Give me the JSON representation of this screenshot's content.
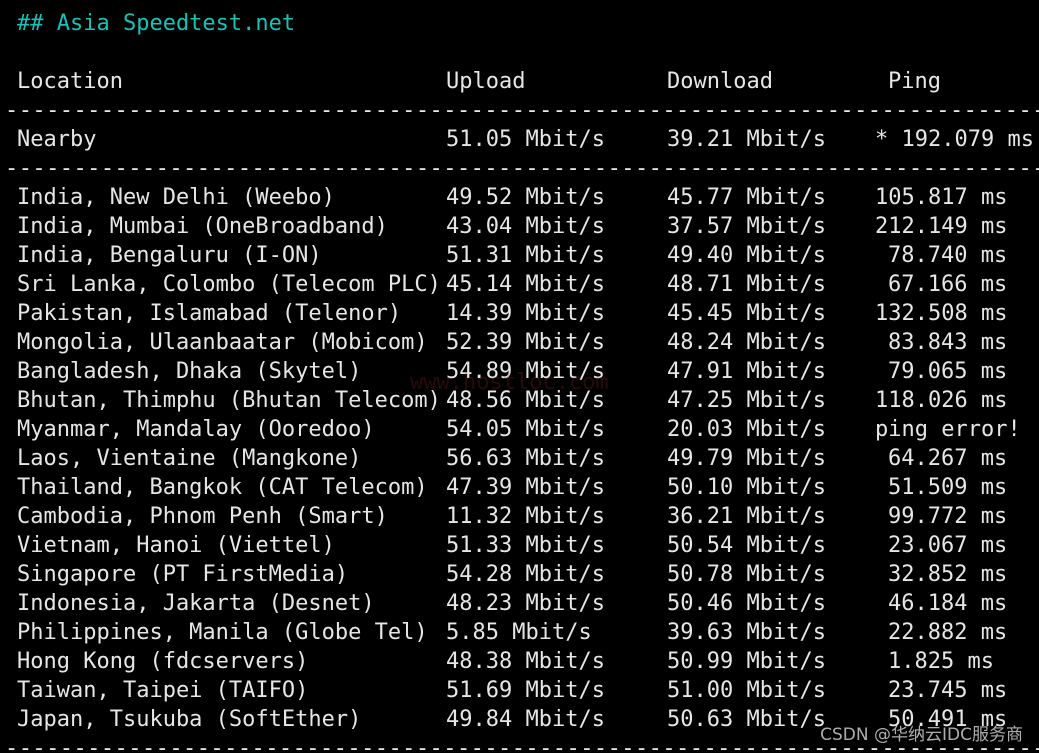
{
  "heading": "## Asia Speedtest.net",
  "columns": {
    "location": "Location",
    "upload": "Upload",
    "download": "Download",
    "ping": "Ping"
  },
  "divider": "----------------------------------------------------------------------------",
  "nearby": {
    "location": "Nearby",
    "upload": "51.05 Mbit/s",
    "download": "39.21 Mbit/s",
    "ping": "* 192.079 ms"
  },
  "rows": [
    {
      "location": "India, New Delhi (Weebo)",
      "upload": "49.52 Mbit/s",
      "download": "45.77 Mbit/s",
      "ping": "105.817 ms"
    },
    {
      "location": "India, Mumbai (OneBroadband)",
      "upload": "43.04 Mbit/s",
      "download": "37.57 Mbit/s",
      "ping": "212.149 ms"
    },
    {
      "location": "India, Bengaluru (I-ON)",
      "upload": "51.31 Mbit/s",
      "download": "49.40 Mbit/s",
      "ping": "78.740 ms"
    },
    {
      "location": "Sri Lanka, Colombo (Telecom PLC)",
      "upload": "45.14 Mbit/s",
      "download": "48.71 Mbit/s",
      "ping": "67.166 ms"
    },
    {
      "location": "Pakistan, Islamabad (Telenor)",
      "upload": "14.39 Mbit/s",
      "download": "45.45 Mbit/s",
      "ping": "132.508 ms"
    },
    {
      "location": "Mongolia, Ulaanbaatar (Mobicom)",
      "upload": "52.39 Mbit/s",
      "download": "48.24 Mbit/s",
      "ping": "83.843 ms"
    },
    {
      "location": "Bangladesh, Dhaka (Skytel)",
      "upload": "54.89 Mbit/s",
      "download": "47.91 Mbit/s",
      "ping": "79.065 ms"
    },
    {
      "location": "Bhutan, Thimphu (Bhutan Telecom)",
      "upload": "48.56 Mbit/s",
      "download": "47.25 Mbit/s",
      "ping": "118.026 ms"
    },
    {
      "location": "Myanmar, Mandalay (Ooredoo)",
      "upload": "54.05 Mbit/s",
      "download": "20.03 Mbit/s",
      "ping": "ping error!"
    },
    {
      "location": "Laos, Vientaine (Mangkone)",
      "upload": "56.63 Mbit/s",
      "download": "49.79 Mbit/s",
      "ping": "64.267 ms"
    },
    {
      "location": "Thailand, Bangkok (CAT Telecom)",
      "upload": "47.39 Mbit/s",
      "download": "50.10 Mbit/s",
      "ping": "51.509 ms"
    },
    {
      "location": "Cambodia, Phnom Penh (Smart)",
      "upload": "11.32 Mbit/s",
      "download": "36.21 Mbit/s",
      "ping": "99.772 ms"
    },
    {
      "location": "Vietnam, Hanoi (Viettel)",
      "upload": "51.33 Mbit/s",
      "download": "50.54 Mbit/s",
      "ping": "23.067 ms"
    },
    {
      "location": "Singapore (PT FirstMedia)",
      "upload": "54.28 Mbit/s",
      "download": "50.78 Mbit/s",
      "ping": "32.852 ms"
    },
    {
      "location": "Indonesia, Jakarta (Desnet)",
      "upload": "48.23 Mbit/s",
      "download": "50.46 Mbit/s",
      "ping": "46.184 ms"
    },
    {
      "location": "Philippines, Manila (Globe Tel)",
      "upload": "5.85 Mbit/s",
      "download": "39.63 Mbit/s",
      "ping": "22.882 ms"
    },
    {
      "location": "Hong Kong (fdcservers)",
      "upload": "48.38 Mbit/s",
      "download": "50.99 Mbit/s",
      "ping": "1.825 ms"
    },
    {
      "location": "Taiwan, Taipei (TAIFO)",
      "upload": "51.69 Mbit/s",
      "download": "51.00 Mbit/s",
      "ping": "23.745 ms"
    },
    {
      "location": "Japan, Tsukuba (SoftEther)",
      "upload": "49.84 Mbit/s",
      "download": "50.63 Mbit/s",
      "ping": "50.491 ms"
    }
  ],
  "credit": "CSDN @华纳云IDC服务商",
  "watermark": "www.hostloc.com",
  "colors": {
    "background": "#000000",
    "text": "#e6e6e6",
    "heading": "#19c2b6"
  }
}
